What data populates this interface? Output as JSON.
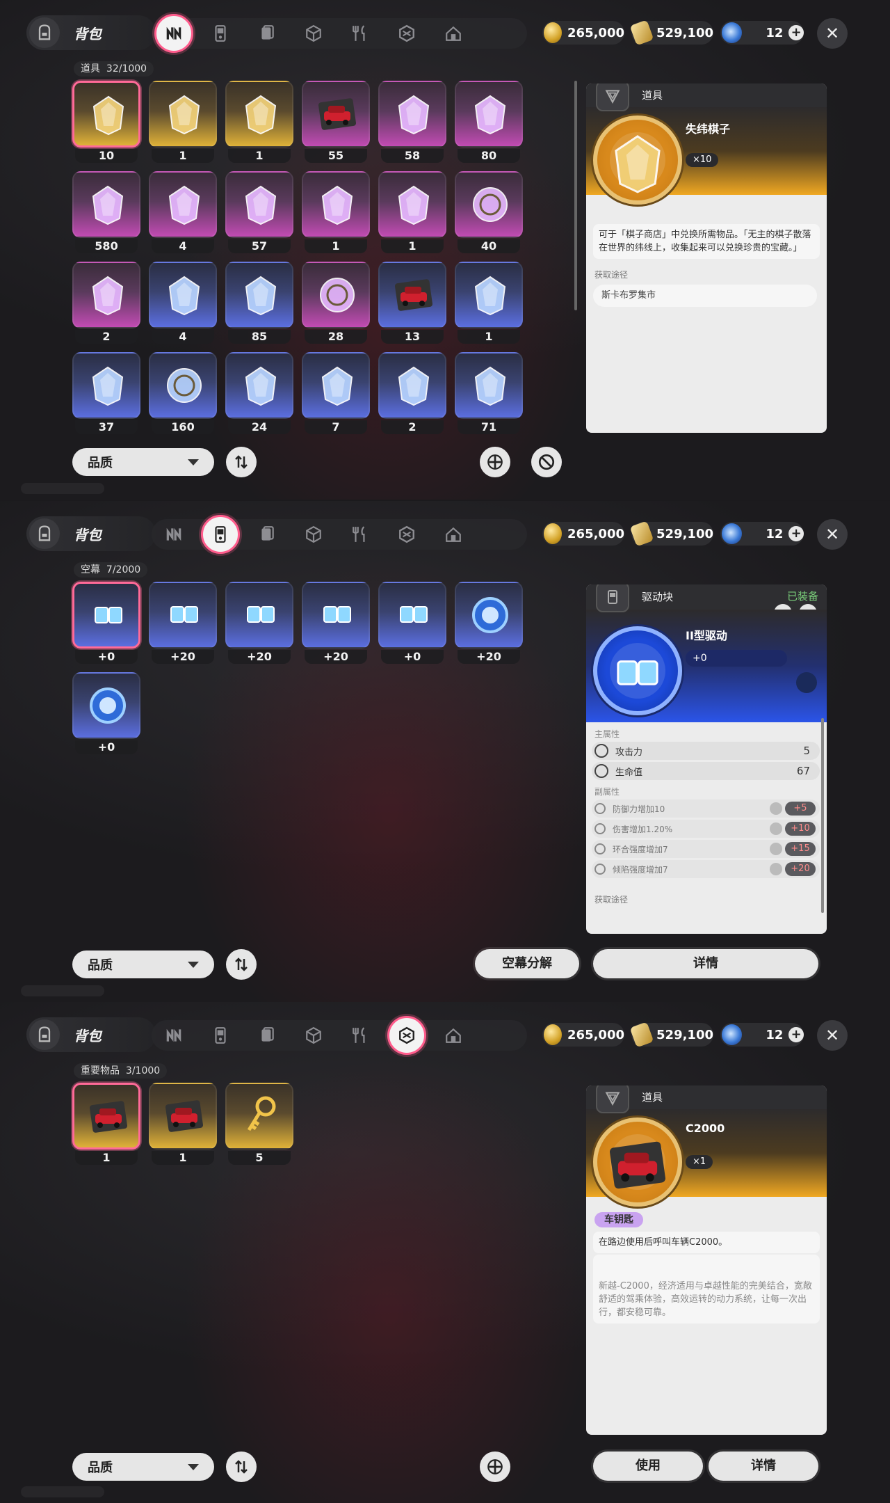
{
  "currency": {
    "coins": "265,000",
    "tickets": "529,100",
    "orbs": "12"
  },
  "bag_title": "背包",
  "sort_label": "品质",
  "panels": [
    {
      "active_tab": 0,
      "category": "道具",
      "capacity": "32/1000",
      "items": [
        {
          "qty": "10",
          "rarity": "gold",
          "icon": "chess-knight-piece-icon"
        },
        {
          "qty": "1",
          "rarity": "gold",
          "icon": "thread-spool-icon"
        },
        {
          "qty": "1",
          "rarity": "gold",
          "icon": "crystal-shard-icon"
        },
        {
          "qty": "55",
          "rarity": "purple",
          "icon": "document-cards-icon"
        },
        {
          "qty": "58",
          "rarity": "purple",
          "icon": "circuit-board-icon"
        },
        {
          "qty": "80",
          "rarity": "purple",
          "icon": "ore-crystals-icon"
        },
        {
          "qty": "580",
          "rarity": "purple",
          "icon": "ice-crystal-icon"
        },
        {
          "qty": "4",
          "rarity": "purple",
          "icon": "potion-bottle-icon"
        },
        {
          "qty": "57",
          "rarity": "purple",
          "icon": "metal-spring-icon"
        },
        {
          "qty": "1",
          "rarity": "purple",
          "icon": "orange-flask-icon"
        },
        {
          "qty": "1",
          "rarity": "purple",
          "icon": "paint-bucket-icon"
        },
        {
          "qty": "40",
          "rarity": "purple",
          "icon": "silver-coin-icon"
        },
        {
          "qty": "2",
          "rarity": "purple",
          "icon": "energy-drink-can-icon"
        },
        {
          "qty": "4",
          "rarity": "blue",
          "icon": "toolbox-icon"
        },
        {
          "qty": "85",
          "rarity": "blue",
          "icon": "holographic-shard-icon"
        },
        {
          "qty": "28",
          "rarity": "purple",
          "icon": "rabbit-badge-icon"
        },
        {
          "qty": "13",
          "rarity": "blue",
          "icon": "instruction-card-icon"
        },
        {
          "qty": "1",
          "rarity": "blue",
          "icon": "canister-icon"
        },
        {
          "qty": "37",
          "rarity": "blue",
          "icon": "shell-fragment-icon"
        },
        {
          "qty": "160",
          "rarity": "blue",
          "icon": "bronze-coin-icon"
        },
        {
          "qty": "24",
          "rarity": "blue",
          "icon": "glowing-berry-icon"
        },
        {
          "qty": "7",
          "rarity": "blue",
          "icon": "snack-bag-icon"
        },
        {
          "qty": "2",
          "rarity": "blue",
          "icon": "wooden-crate-icon"
        },
        {
          "qty": "71",
          "rarity": "blue",
          "icon": "paint-tube-icon"
        }
      ],
      "detail": {
        "type": "item",
        "header": "道具",
        "name": "失纬棋子",
        "count": "×10",
        "desc": "可于「棋子商店」中兑换所需物品。「无主的棋子散落在世界的纬线上，收集起来可以兑换珍贵的宝藏。」",
        "source_title": "获取途径",
        "source": "斯卡布罗集市"
      }
    },
    {
      "active_tab": 1,
      "category": "空幕",
      "capacity": "7/2000",
      "items": [
        {
          "qty": "+0",
          "rarity": "blue",
          "icon": "domino-block-icon"
        },
        {
          "qty": "+20",
          "rarity": "blue",
          "icon": "vertical-block-icon"
        },
        {
          "qty": "+20",
          "rarity": "blue",
          "icon": "l-block-icon"
        },
        {
          "qty": "+20",
          "rarity": "blue",
          "icon": "j-block-icon"
        },
        {
          "qty": "+0",
          "rarity": "blue",
          "icon": "i-block-icon"
        },
        {
          "qty": "+20",
          "rarity": "blue",
          "icon": "compass-disc-icon"
        },
        {
          "qty": "+0",
          "rarity": "blue",
          "icon": "lightning-disc-icon"
        }
      ],
      "detail": {
        "type": "drive",
        "header": "驱动块",
        "equipped": "已装备",
        "name": "II型驱动",
        "level": "+0",
        "main_label": "主属性",
        "stats": [
          {
            "label": "攻击力",
            "value": "5"
          },
          {
            "label": "生命值",
            "value": "67"
          }
        ],
        "sub_label": "副属性",
        "substats": [
          {
            "label": "防御力增加10",
            "value": "+5"
          },
          {
            "label": "伤害增加1.20%",
            "value": "+10"
          },
          {
            "label": "环合强度增加7",
            "value": "+15"
          },
          {
            "label": "倾陷强度增加7",
            "value": "+20"
          }
        ],
        "source_title": "获取途径"
      },
      "buttons": {
        "decompose": "空幕分解",
        "details": "详情"
      }
    },
    {
      "active_tab": 5,
      "category": "重要物品",
      "capacity": "3/1000",
      "items": [
        {
          "qty": "1",
          "rarity": "gold",
          "icon": "red-car-icon"
        },
        {
          "qty": "1",
          "rarity": "gold",
          "icon": "red-scooter-icon"
        },
        {
          "qty": "5",
          "rarity": "gold",
          "icon": "golden-key-icon"
        }
      ],
      "detail": {
        "type": "key",
        "header": "道具",
        "name": "C2000",
        "count": "×1",
        "tag": "车钥匙",
        "desc1": "在路边使用后呼叫车辆C2000。",
        "desc2": "新越-C2000，经济适用与卓越性能的完美结合，宽敞舒适的驾乘体验，高效运转的动力系统，让每一次出行，都安稳可靠。"
      },
      "buttons": {
        "use": "使用",
        "details": "详情"
      }
    }
  ],
  "tabs": [
    "chip-tab-icon",
    "handheld-device-tab-icon",
    "card-tab-icon",
    "cube-tab-icon",
    "cutlery-tab-icon",
    "package-tab-icon",
    "home-tab-icon"
  ]
}
